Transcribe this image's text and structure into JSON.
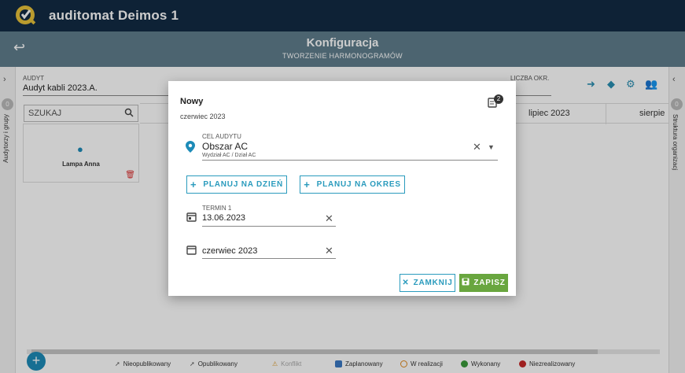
{
  "app": {
    "title": "auditomat Deimos 1"
  },
  "header": {
    "title": "Konfiguracja",
    "subtitle": "TWORZENIE HARMONOGRAMÓW"
  },
  "filters": {
    "audyt_label": "AUDYT",
    "audyt_value": "Audyt kabli 2023.A.",
    "liczba_label": "LICZBA OKR."
  },
  "search": {
    "placeholder": "SZUKAJ"
  },
  "columns": [
    "lipiec 2023",
    "sierpie"
  ],
  "people": [
    {
      "name": "Lampa Anna"
    }
  ],
  "side": {
    "left_label": "Audytorzy i grupy",
    "left_badge": "0",
    "right_label": "Struktura organizacj",
    "right_badge": "0"
  },
  "modal": {
    "title": "Nowy",
    "subtitle": "czerwiec 2023",
    "badge": "2",
    "target_label": "CEL AUDYTU",
    "target_value": "Obszar AC",
    "target_path": "Wydział AC / Dział AC",
    "btn_day": "PLANUJ NA DZIEŃ",
    "btn_period": "PLANUJ NA OKRES",
    "term_label": "TERMIN 1",
    "term_date": "13.06.2023",
    "term_month": "czerwiec 2023",
    "btn_close": "ZAMKNIJ",
    "btn_save": "ZAPISZ"
  },
  "legend": [
    {
      "label": "Nieopublikowany",
      "color": "#555555"
    },
    {
      "label": "Opublikowany",
      "color": "#555555"
    },
    {
      "label": "Konflikt",
      "color": "#e0a030"
    },
    {
      "label": "Zaplanowany",
      "color": "#3a78c4"
    },
    {
      "label": "W realizacji",
      "color": "#e08a1e"
    },
    {
      "label": "Wykonany",
      "color": "#3a9a3a"
    },
    {
      "label": "Niezrealizowany",
      "color": "#c62828"
    }
  ],
  "colors": {
    "topbar": "#122b44",
    "subbar": "#5f7e8d",
    "accent": "#2a9bbd",
    "save": "#69a63f"
  }
}
